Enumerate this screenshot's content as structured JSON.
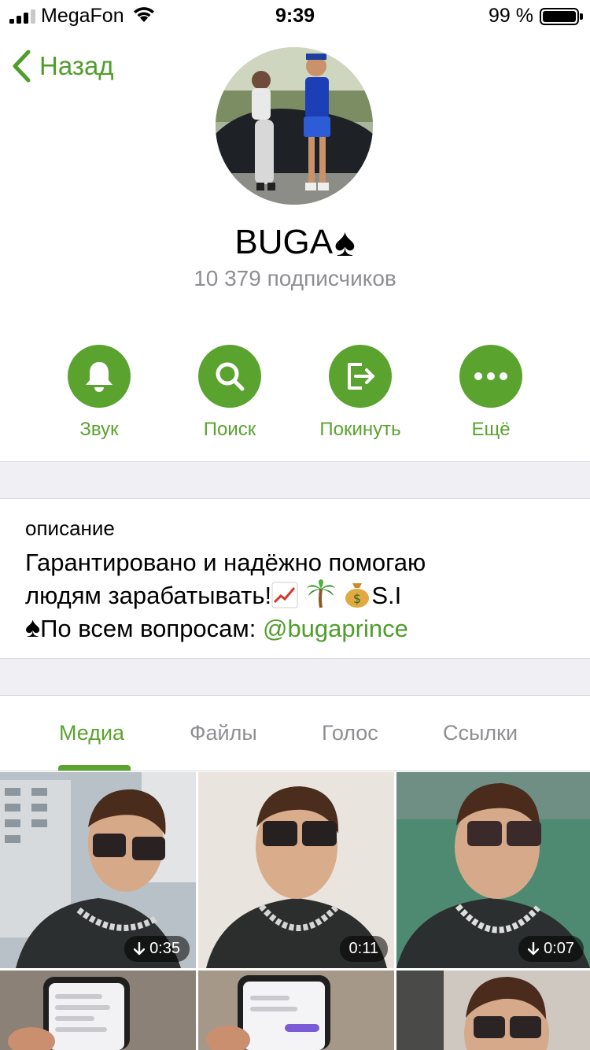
{
  "status_bar": {
    "carrier": "MegaFon",
    "time": "9:39",
    "battery_percent": "99 %",
    "signal_bars": 3,
    "signal_bars_total": 4,
    "battery_level": 0.99
  },
  "nav": {
    "back_label": "Назад",
    "back_icon": "chevron-left-icon"
  },
  "channel": {
    "name": "BUGA",
    "name_emoji": "♠",
    "subscribers": "10 379 подписчиков"
  },
  "actions": [
    {
      "label": "Звук",
      "icon": "bell-icon"
    },
    {
      "label": "Поиск",
      "icon": "search-icon"
    },
    {
      "label": "Покинуть",
      "icon": "leave-icon"
    },
    {
      "label": "Ещё",
      "icon": "more-icon"
    }
  ],
  "description": {
    "label": "описание",
    "line1": "Гарантировано и надёжно помогаю",
    "line2_text": "людям зарабатывать!",
    "line2_suffix": "S.I",
    "line3_prefix": "♠",
    "line3_text": "По всем вопросам: ",
    "link": "@bugaprince",
    "emojis": [
      "chart-increasing-icon",
      "palm-tree-icon",
      "money-bag-icon"
    ]
  },
  "tabs": [
    {
      "label": "Медиа",
      "active": true
    },
    {
      "label": "Файлы",
      "active": false
    },
    {
      "label": "Голос",
      "active": false
    },
    {
      "label": "Ссылки",
      "active": false
    }
  ],
  "media": [
    {
      "duration": "0:35",
      "download_icon": true
    },
    {
      "duration": "0:11",
      "download_icon": false
    },
    {
      "duration": "0:07",
      "download_icon": true
    },
    {
      "duration": "",
      "download_icon": false
    },
    {
      "duration": "",
      "download_icon": false
    },
    {
      "duration": "",
      "download_icon": false
    }
  ],
  "colors": {
    "accent": "#5ba32f",
    "link": "#4f9d2a",
    "secondary_text": "#8e8e93",
    "separator_bg": "#efeff4"
  }
}
